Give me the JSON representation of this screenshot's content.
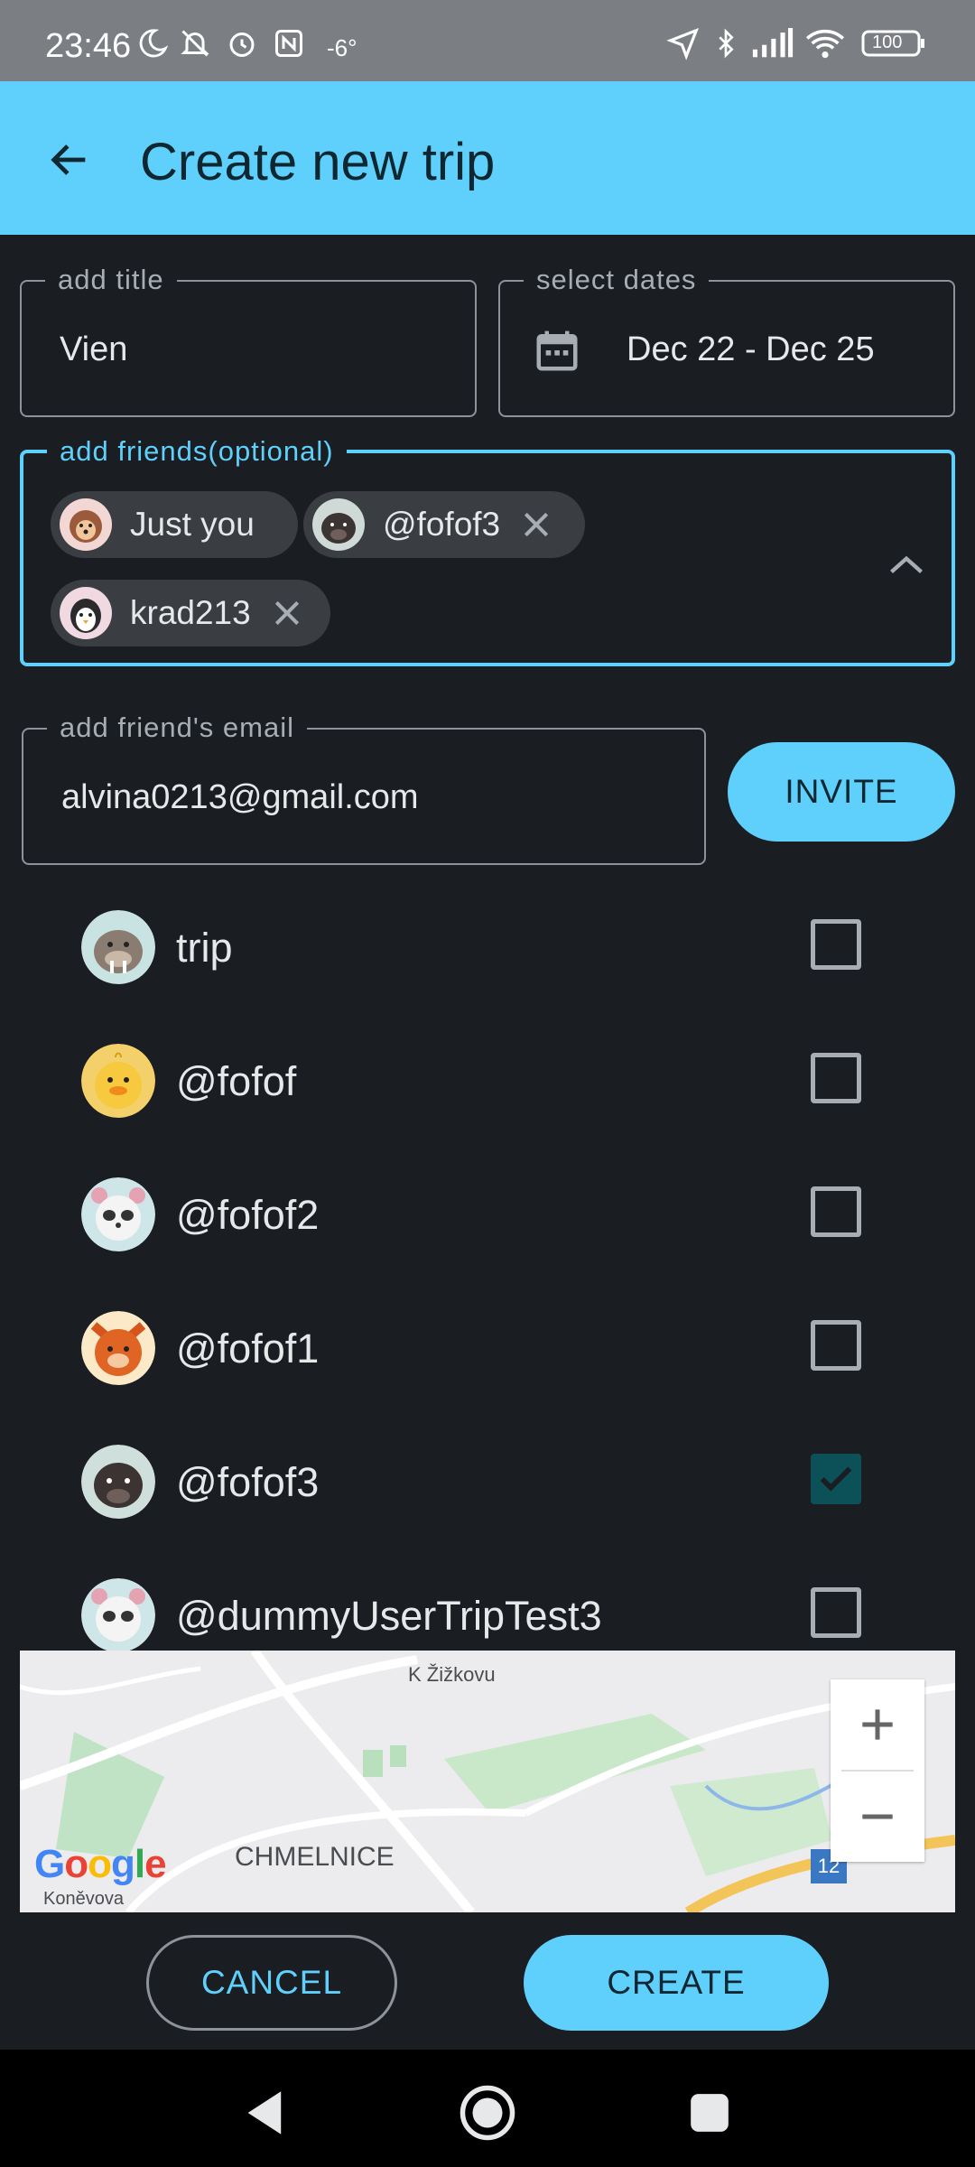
{
  "status_bar": {
    "time": "23:46",
    "temperature": "-6°",
    "battery": "100",
    "icons": [
      "moon-icon",
      "bell-off-icon",
      "alarm-icon",
      "nfc-icon",
      "location-arrow-icon",
      "bluetooth-icon",
      "signal-icon",
      "wifi-icon",
      "battery-icon"
    ]
  },
  "header": {
    "title": "Create new trip",
    "back_icon": "arrow-left-icon"
  },
  "form": {
    "title_field": {
      "label": "add title",
      "value": "Vien"
    },
    "dates_field": {
      "label": "select dates",
      "value": "Dec 22 - Dec 25",
      "icon": "calendar-icon"
    },
    "friends_field": {
      "label": "add friends(optional)",
      "chips": [
        {
          "label": "Just you",
          "removable": false
        },
        {
          "label": "@fofof3",
          "removable": true
        },
        {
          "label": "krad213",
          "removable": true
        }
      ],
      "toggle_icon": "chevron-up-icon"
    },
    "email_field": {
      "label": "add friend's email",
      "value": "alvina0213@gmail.com"
    },
    "invite_label": "INVITE"
  },
  "friends_list": [
    {
      "name": "trip",
      "checked": false,
      "avatar": "walrus"
    },
    {
      "name": "@fofof",
      "checked": false,
      "avatar": "chick"
    },
    {
      "name": "@fofof2",
      "checked": false,
      "avatar": "panda"
    },
    {
      "name": "@fofof1",
      "checked": false,
      "avatar": "fox"
    },
    {
      "name": "@fofof3",
      "checked": true,
      "avatar": "mole"
    },
    {
      "name": "@dummyUserTripTest3",
      "checked": false,
      "avatar": "panda"
    }
  ],
  "map": {
    "labels": [
      "K Žižkovu",
      "CHMELNICE",
      "Koněvova"
    ],
    "route_badge": "12",
    "provider": "Google"
  },
  "actions": {
    "cancel_label": "CANCEL",
    "create_label": "CREATE"
  },
  "colors": {
    "accent": "#5fd0fb",
    "background": "#1a1d21",
    "checkbox_checked": "#0d5158"
  }
}
